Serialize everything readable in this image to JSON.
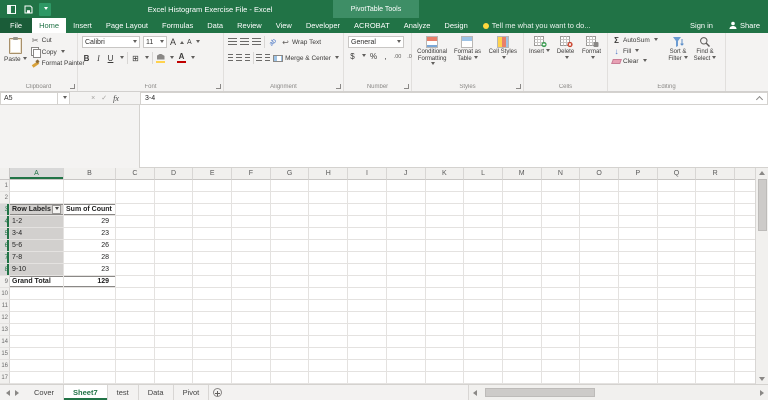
{
  "colors": {
    "accent": "#217346",
    "selection_fill": "#d2d0ce",
    "ribbon_bg": "#f4f3f2"
  },
  "title_bar": {
    "title": "Excel Histogram Exercise File - Excel",
    "context_tools": "PivotTable Tools"
  },
  "ribbon_tabs": {
    "file": "File",
    "tabs": [
      "Home",
      "Insert",
      "Page Layout",
      "Formulas",
      "Data",
      "Review",
      "View",
      "Developer",
      "ACROBAT"
    ],
    "context_tabs": [
      "Analyze",
      "Design"
    ],
    "active": "Home",
    "tell_me": "Tell me what you want to do...",
    "sign_in": "Sign in",
    "share": "Share"
  },
  "icons": {
    "scissors": "✂",
    "borders": "⊞",
    "sigma": "Σ",
    "fill_arrow": "↓",
    "wrap": "↩",
    "orientation": "ab",
    "cancel": "×",
    "enter": "✓",
    "fx": "fx"
  },
  "ribbon": {
    "clipboard": {
      "label": "Clipboard",
      "paste": "Paste",
      "cut": "Cut",
      "copy": "Copy",
      "format_painter": "Format Painter"
    },
    "font": {
      "label": "Font",
      "name": "Calibri",
      "size": "11",
      "bold": "B",
      "italic": "I",
      "underline": "U",
      "grow": "A",
      "shrink": "A",
      "color_a": "A"
    },
    "alignment": {
      "label": "Alignment",
      "wrap": "Wrap Text",
      "merge": "Merge & Center"
    },
    "number": {
      "label": "Number",
      "format": "General",
      "currency": "$",
      "percent": "%",
      "comma": ",",
      "inc": ".00",
      "dec": ".0"
    },
    "styles": {
      "label": "Styles",
      "conditional": "Conditional Formatting",
      "table": "Format as Table",
      "cell": "Cell Styles"
    },
    "cells": {
      "label": "Cells",
      "insert": "Insert",
      "delete": "Delete",
      "format": "Format"
    },
    "editing": {
      "label": "Editing",
      "autosum": "AutoSum",
      "fill": "Fill",
      "clear": "Clear",
      "sort": "Sort & Filter",
      "find": "Find & Select"
    }
  },
  "formula_bar": {
    "name_box": "A5",
    "content": "3-4"
  },
  "grid": {
    "columns": [
      "A",
      "B",
      "C",
      "D",
      "E",
      "F",
      "G",
      "H",
      "I",
      "J",
      "K",
      "L",
      "M",
      "N",
      "O",
      "P",
      "Q",
      "R"
    ],
    "row_count": 17,
    "selection": {
      "column": "A",
      "row_start": 3,
      "row_end": 8
    },
    "pivot": {
      "header_row": 3,
      "data_start_row": 4,
      "total_row": 9,
      "headers": [
        "Row Labels",
        "Sum of Count"
      ],
      "rows": [
        [
          "1-2",
          "29"
        ],
        [
          "3-4",
          "23"
        ],
        [
          "5-6",
          "26"
        ],
        [
          "7-8",
          "28"
        ],
        [
          "9-10",
          "23"
        ]
      ],
      "total": [
        "Grand Total",
        "129"
      ]
    }
  },
  "sheet_tabs": {
    "tabs": [
      "Cover",
      "Sheet7",
      "test",
      "Data",
      "Pivot"
    ],
    "active": "Sheet7"
  }
}
